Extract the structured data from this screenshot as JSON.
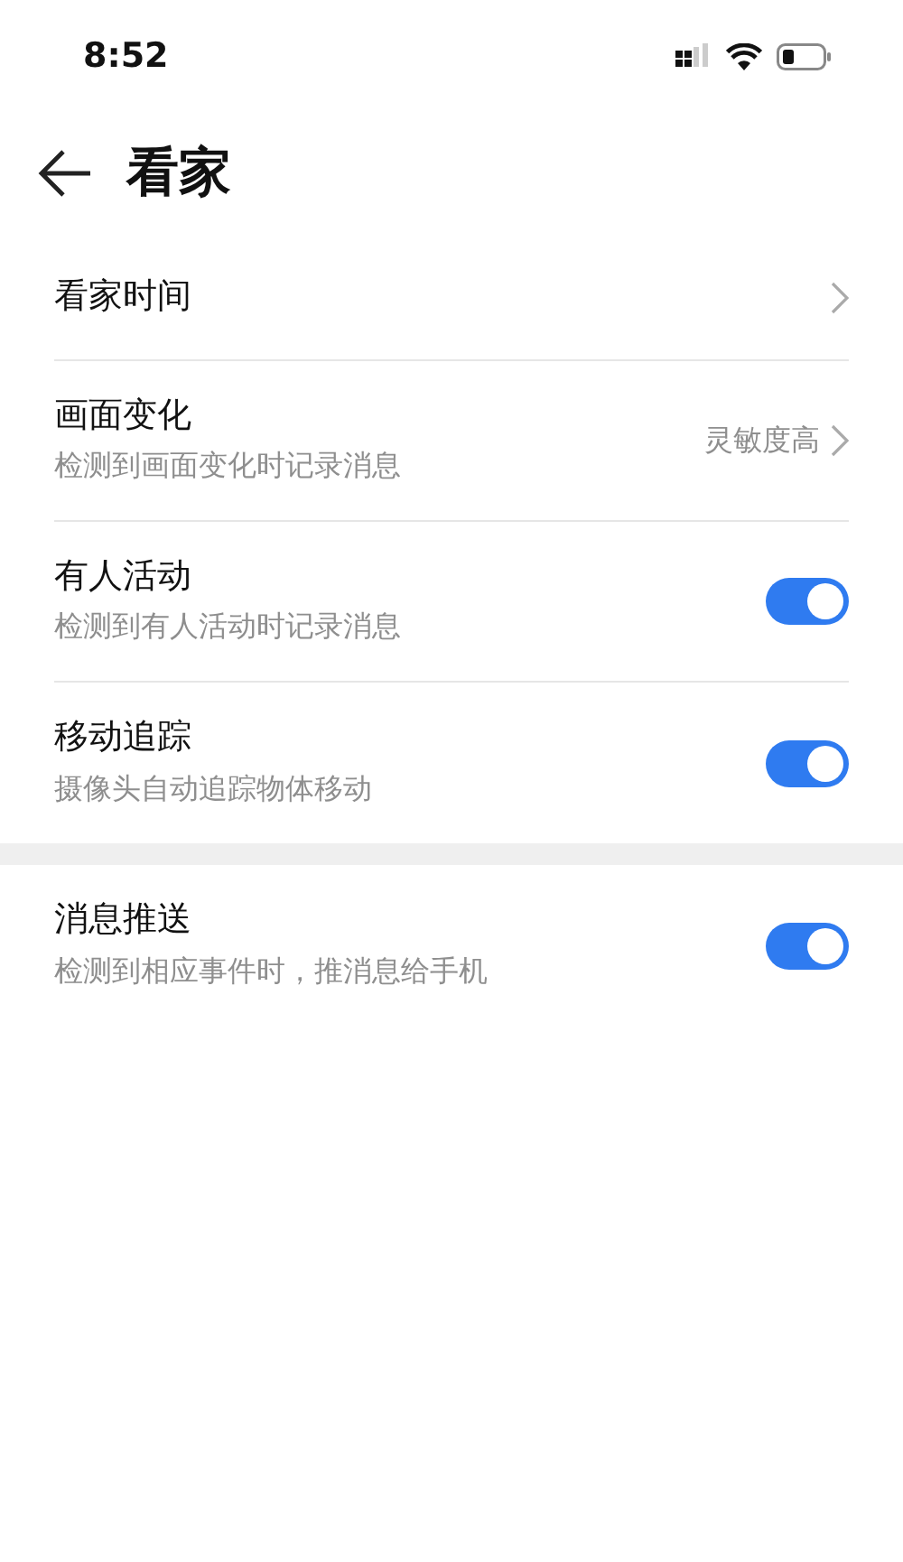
{
  "status_bar": {
    "time": "8:52"
  },
  "header": {
    "title": "看家"
  },
  "sections": [
    {
      "items": [
        {
          "kind": "link",
          "title": "看家时间"
        },
        {
          "kind": "link",
          "title": "画面变化",
          "subtitle": "检测到画面变化时记录消息",
          "value": "灵敏度高"
        },
        {
          "kind": "toggle",
          "title": "有人活动",
          "subtitle": "检测到有人活动时记录消息",
          "on": true
        },
        {
          "kind": "toggle",
          "title": "移动追踪",
          "subtitle": "摄像头自动追踪物体移动",
          "on": true
        }
      ]
    },
    {
      "items": [
        {
          "kind": "toggle",
          "title": "消息推送",
          "subtitle": "检测到相应事件时，推消息给手机",
          "on": true
        }
      ]
    }
  ]
}
